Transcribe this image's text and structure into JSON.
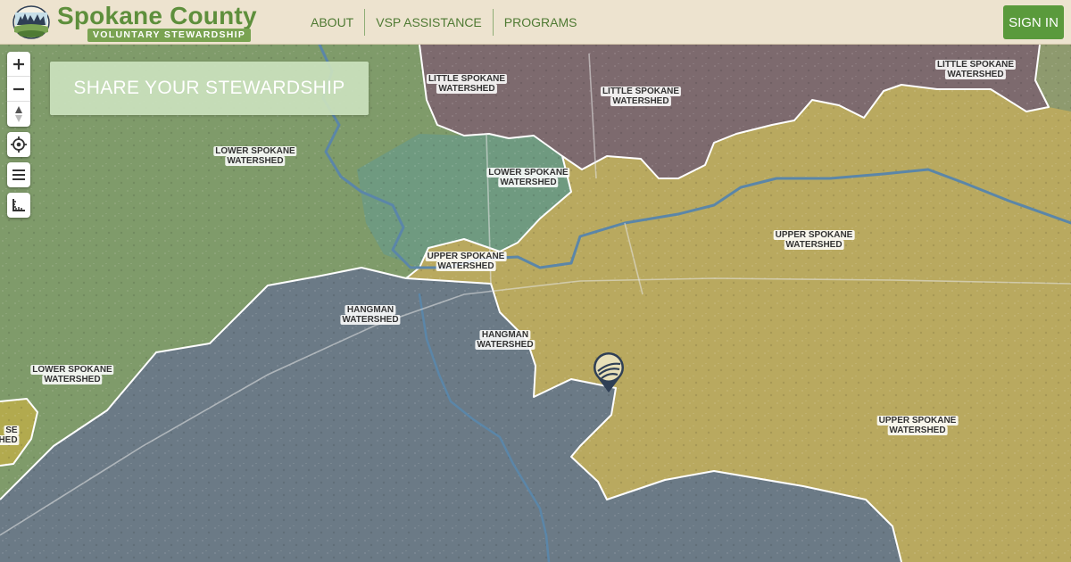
{
  "header": {
    "brand_title": "Spokane County",
    "brand_subtitle": "VOLUNTARY STEWARDSHIP",
    "nav": [
      "ABOUT",
      "VSP ASSISTANCE",
      "PROGRAMS"
    ],
    "signin_label": "SIGN IN"
  },
  "map": {
    "share_label": "SHARE YOUR STEWARDSHIP",
    "watersheds": [
      {
        "line1": "LITTLE SPOKANE",
        "line2": "WATERSHED"
      },
      {
        "line1": "LITTLE SPOKANE",
        "line2": "WATERSHED"
      },
      {
        "line1": "LITTLE SPOKANE",
        "line2": "WATERSHED"
      },
      {
        "line1": "LOWER SPOKANE",
        "line2": "WATERSHED"
      },
      {
        "line1": "LOWER SPOKANE",
        "line2": "WATERSHED"
      },
      {
        "line1": "LOWER SPOKANE",
        "line2": "WATERSHED"
      },
      {
        "line1": "UPPER SPOKANE",
        "line2": "WATERSHED"
      },
      {
        "line1": "UPPER SPOKANE",
        "line2": "WATERSHED"
      },
      {
        "line1": "UPPER SPOKANE",
        "line2": "WATERSHED"
      },
      {
        "line1": "HANGMAN",
        "line2": "WATERSHED"
      },
      {
        "line1": "HANGMAN",
        "line2": "WATERSHED"
      },
      {
        "line1": "SE",
        "line2": "HED"
      }
    ],
    "controls": [
      "zoom-in",
      "zoom-out",
      "compass",
      "locate",
      "layers",
      "measure"
    ],
    "colors": {
      "little_spokane": "#7d6a6e",
      "lower_spokane": "#7f9b6a",
      "upper_spokane": "#b9a95f",
      "hangman": "#6b7a86",
      "brand_green": "#5e8f3c"
    }
  }
}
